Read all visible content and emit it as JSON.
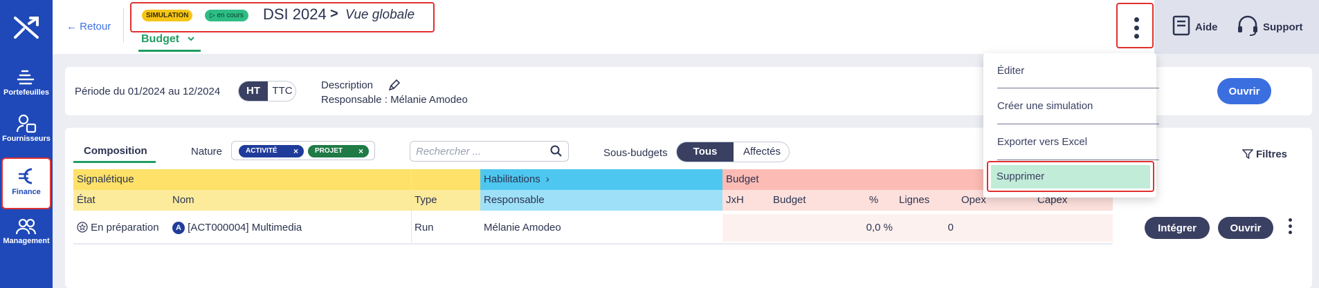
{
  "nav": {
    "items": [
      {
        "label": "Portefeuilles",
        "icon": "portfolio-icon"
      },
      {
        "label": "Fournisseurs",
        "icon": "supplier-icon"
      },
      {
        "label": "Finance",
        "icon": "euro-icon"
      },
      {
        "label": "Management",
        "icon": "users-icon"
      }
    ]
  },
  "header": {
    "back": "← Retour",
    "badge_simulation": "SIMULATION",
    "badge_status": "▷ en cours",
    "title": "DSI 2024",
    "separator": ">",
    "subtitle": "Vue globale",
    "tab": "Budget",
    "help": "Aide",
    "support": "Support"
  },
  "summary": {
    "period": "Période du 01/2024 au 12/2024",
    "toggle_ht": "HT",
    "toggle_ttc": "TTC",
    "description_label": "Description",
    "responsible": "Responsable : Mélanie Amodeo",
    "open": "Ouvrir"
  },
  "toolbar": {
    "tab": "Composition",
    "nature_label": "Nature",
    "chips": [
      "ACTIVITÉ",
      "PROJET"
    ],
    "search_placeholder": "Rechercher ...",
    "subbudgets_label": "Sous-budgets",
    "seg_all": "Tous",
    "seg_assigned": "Affectés",
    "filters": "Filtres"
  },
  "table": {
    "groups": {
      "signaletique": "Signalétique",
      "habilitations": "Habilitations",
      "budget": "Budget"
    },
    "columns": {
      "etat": "État",
      "nom": "Nom",
      "type": "Type",
      "responsable": "Responsable",
      "jxh": "JxH",
      "budget": "Budget",
      "pct": "%",
      "lignes": "Lignes",
      "opex": "Opex",
      "capex": "Capex"
    },
    "rows": [
      {
        "etat": "En préparation",
        "nom_badge": "A",
        "nom": "[ACT000004] Multimedia",
        "type": "Run",
        "responsable": "Mélanie Amodeo",
        "pct": "0,0 %",
        "lignes": "0"
      }
    ],
    "row_actions": {
      "integrate": "Intégrer",
      "open": "Ouvrir"
    }
  },
  "menu": {
    "items": [
      "Éditer",
      "Créer une simulation",
      "Exporter vers Excel",
      "Supprimer"
    ]
  },
  "colors": {
    "sidebar": "#1f49b8",
    "signaletique_group": "#fde168",
    "signaletique_header": "#fdeb9c",
    "habilitations_group": "#4dc7f0",
    "habilitations_header": "#9de0f7",
    "budget_group": "#fcbcb5",
    "budget_header": "#fde0dc",
    "budget_row": "#fdf1ef",
    "accent_green": "#1f9d62",
    "chip_activity": "#1f3c9b",
    "chip_project": "#1f7a46"
  }
}
